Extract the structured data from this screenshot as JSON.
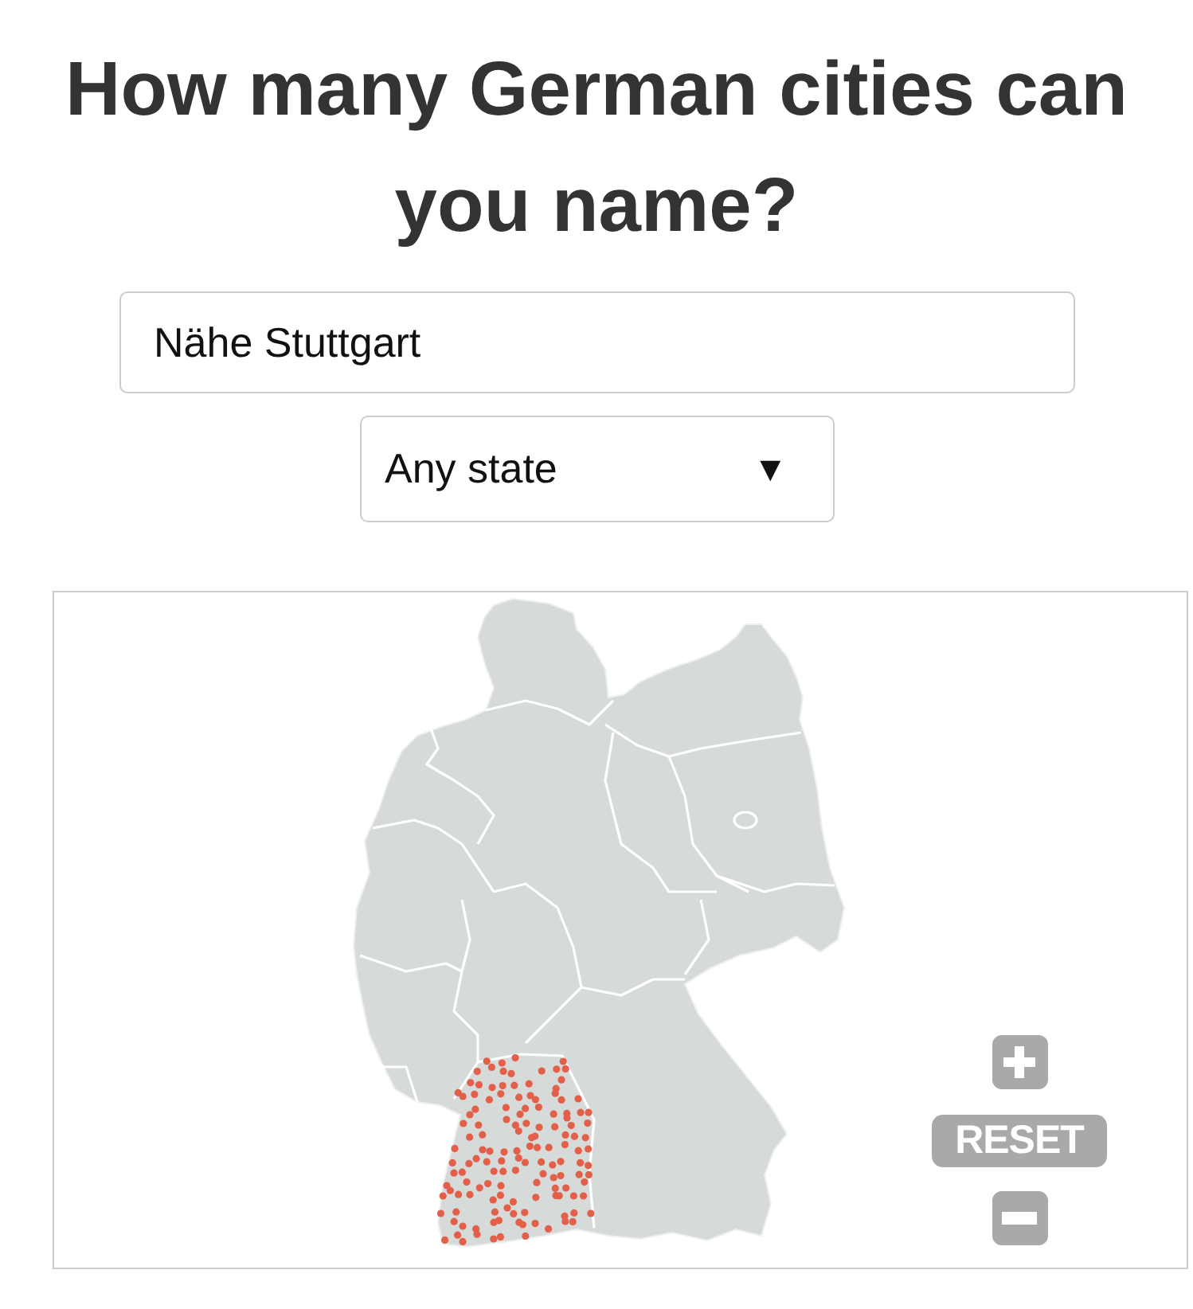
{
  "title": "How many German cities can you name?",
  "city_input": {
    "value": "Nähe Stuttgart"
  },
  "state_select": {
    "value": "Any state",
    "arrow": "▼"
  },
  "map": {
    "zoom_controls": {
      "reset": "RESET"
    }
  }
}
